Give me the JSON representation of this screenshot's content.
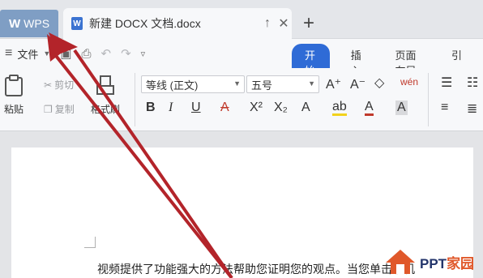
{
  "tabs": {
    "wps_label": "WPS",
    "doc_icon_letter": "W",
    "doc_title": "新建 DOCX 文档.docx",
    "pin_glyph": "↑",
    "close_glyph": "✕",
    "add_glyph": "+"
  },
  "menu": {
    "file_label": "文件",
    "ribbon_tabs": [
      "开始",
      "插入",
      "页面布局",
      "引"
    ]
  },
  "ribbon": {
    "paste_label": "粘贴",
    "cut_label": "剪切",
    "copy_label": "复制",
    "format_painter_label": "格式刷",
    "font_name": "等线 (正文)",
    "font_size": "五号",
    "bold": "B",
    "italic": "I",
    "underline": "U",
    "strike": "A",
    "superscript": "X²",
    "subscript": "X₂",
    "text_effect": "A",
    "highlight": "ab",
    "font_color": "A",
    "char_shade": "A",
    "grow": "A⁺",
    "shrink": "A⁻",
    "clear": "◇",
    "pinyin": "wén"
  },
  "document": {
    "text": "视频提供了功能强大的方法帮助您证明您的观点。当您单击联机"
  },
  "watermark": {
    "text_main": "PPT",
    "text_accent": "家园"
  },
  "colors": {
    "accent": "#2f6bd6",
    "wps_tab": "#7f9ec4",
    "arrow": "#b3242a"
  }
}
